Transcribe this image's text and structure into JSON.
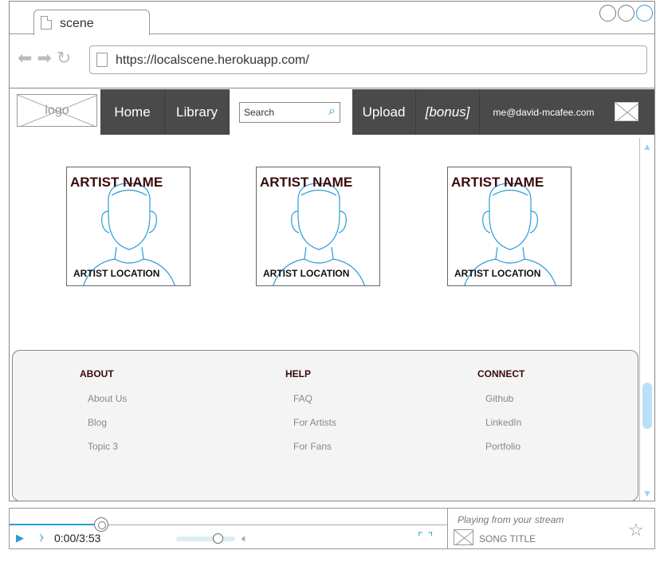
{
  "browser": {
    "tab_title": "scene",
    "url": "https://localscene.herokuapp.com/",
    "nav_icons": [
      "back-arrow-icon",
      "forward-arrow-icon",
      "refresh-icon"
    ]
  },
  "navbar": {
    "logo": "logo",
    "home": "Home",
    "library": "Library",
    "search_placeholder": "Search",
    "upload": "Upload",
    "bonus": "[bonus]",
    "email": "me@david-mcafee.com"
  },
  "artists": [
    {
      "name": "ARTIST NAME",
      "location": "ARTIST LOCATION"
    },
    {
      "name": "ARTIST NAME",
      "location": "ARTIST LOCATION"
    },
    {
      "name": "ARTIST NAME",
      "location": "ARTIST LOCATION"
    }
  ],
  "footer": {
    "about": {
      "title": "ABOUT",
      "links": [
        "About Us",
        "Blog",
        "Topic 3"
      ]
    },
    "help": {
      "title": "HELP",
      "links": [
        "FAQ",
        "For Artists",
        "For Fans"
      ]
    },
    "connect": {
      "title": "CONNECT",
      "links": [
        "Github",
        "LinkedIn",
        "Portfolio"
      ]
    }
  },
  "player": {
    "time": "0:00/3:53",
    "stream_label": "Playing from your stream",
    "song_title": "SONG TITLE",
    "progress": 0.21,
    "volume": 0.7
  },
  "colors": {
    "accent": "#2b9bd8",
    "navbar": "#4a4a4a",
    "heading": "#3a0a0a"
  }
}
